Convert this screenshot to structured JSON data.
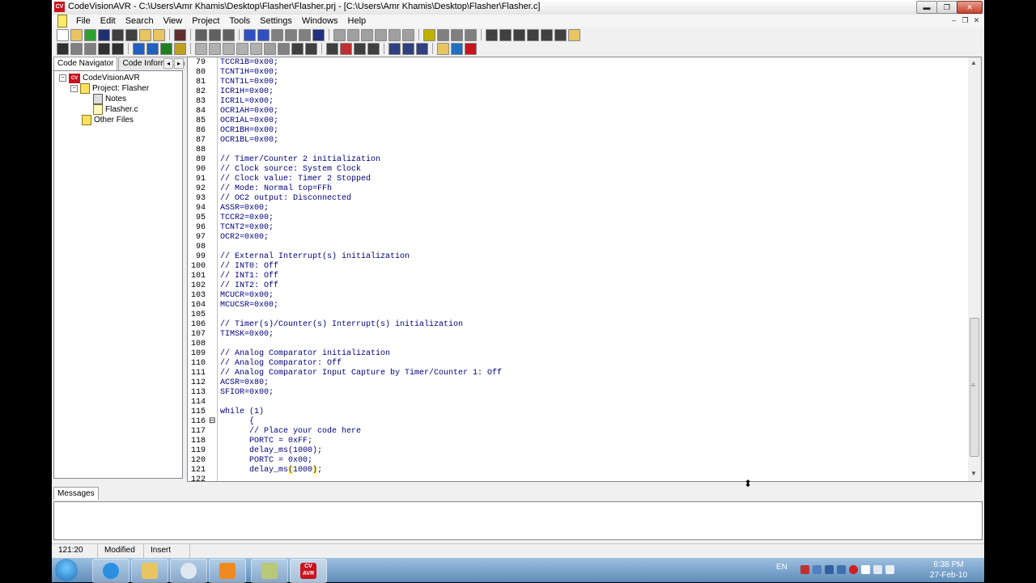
{
  "window": {
    "title": "CodeVisionAVR - C:\\Users\\Amr Khamis\\Desktop\\Flasher\\Flasher.prj - [C:\\Users\\Amr Khamis\\Desktop\\Flasher\\Flasher.c]",
    "app_icon_text": "CV",
    "controls": {
      "minimize": "▬",
      "maximize": "❐",
      "close": "✕"
    }
  },
  "menu": [
    "File",
    "Edit",
    "Search",
    "View",
    "Project",
    "Tools",
    "Settings",
    "Windows",
    "Help"
  ],
  "mdi_controls": {
    "minimize": "–",
    "restore": "❐",
    "close": "✕"
  },
  "left_panel": {
    "tabs": [
      "Code Navigator",
      "Code Information"
    ],
    "arrows": [
      "◂",
      "▸"
    ],
    "tree": {
      "root": "CodeVisionAVR",
      "project": "Project: Flasher",
      "notes": "Notes",
      "file": "Flasher.c",
      "other": "Other Files",
      "expand_glyph": "−"
    }
  },
  "editor": {
    "lines": [
      {
        "n": "79",
        "t": "TCCR1B=0x00;"
      },
      {
        "n": "80",
        "t": "TCNT1H=0x00;"
      },
      {
        "n": "81",
        "t": "TCNT1L=0x00;"
      },
      {
        "n": "82",
        "t": "ICR1H=0x00;"
      },
      {
        "n": "83",
        "t": "ICR1L=0x00;"
      },
      {
        "n": "84",
        "t": "OCR1AH=0x00;"
      },
      {
        "n": "85",
        "t": "OCR1AL=0x00;"
      },
      {
        "n": "86",
        "t": "OCR1BH=0x00;"
      },
      {
        "n": "87",
        "t": "OCR1BL=0x00;"
      },
      {
        "n": "88",
        "t": ""
      },
      {
        "n": "89",
        "t": "// Timer/Counter 2 initialization"
      },
      {
        "n": "90",
        "t": "// Clock source: System Clock"
      },
      {
        "n": "91",
        "t": "// Clock value: Timer 2 Stopped"
      },
      {
        "n": "92",
        "t": "// Mode: Normal top=FFh"
      },
      {
        "n": "93",
        "t": "// OC2 output: Disconnected"
      },
      {
        "n": "94",
        "t": "ASSR=0x00;"
      },
      {
        "n": "95",
        "t": "TCCR2=0x00;"
      },
      {
        "n": "96",
        "t": "TCNT2=0x00;"
      },
      {
        "n": "97",
        "t": "OCR2=0x00;"
      },
      {
        "n": "98",
        "t": ""
      },
      {
        "n": "99",
        "t": "// External Interrupt(s) initialization"
      },
      {
        "n": "100",
        "t": "// INT0: Off"
      },
      {
        "n": "101",
        "t": "// INT1: Off"
      },
      {
        "n": "102",
        "t": "// INT2: Off"
      },
      {
        "n": "103",
        "t": "MCUCR=0x00;"
      },
      {
        "n": "104",
        "t": "MCUCSR=0x00;"
      },
      {
        "n": "105",
        "t": ""
      },
      {
        "n": "106",
        "t": "// Timer(s)/Counter(s) Interrupt(s) initialization"
      },
      {
        "n": "107",
        "t": "TIMSK=0x00;"
      },
      {
        "n": "108",
        "t": ""
      },
      {
        "n": "109",
        "t": "// Analog Comparator initialization"
      },
      {
        "n": "110",
        "t": "// Analog Comparator: Off"
      },
      {
        "n": "111",
        "t": "// Analog Comparator Input Capture by Timer/Counter 1: Off"
      },
      {
        "n": "112",
        "t": "ACSR=0x80;"
      },
      {
        "n": "113",
        "t": "SFIOR=0x00;"
      },
      {
        "n": "114",
        "t": ""
      },
      {
        "n": "115",
        "t": "while (1)"
      },
      {
        "n": "116",
        "t": "      {"
      },
      {
        "n": "117",
        "t": "      // Place your code here"
      },
      {
        "n": "118",
        "t": "      PORTC = 0xFF;"
      },
      {
        "n": "119",
        "t": "      delay_ms(1000);"
      },
      {
        "n": "120",
        "t": "      PORTC = 0x00;"
      },
      {
        "n": "121",
        "t": "      delay_ms(1000);"
      },
      {
        "n": "122",
        "t": ""
      }
    ],
    "fold_glyph": "⊟",
    "line121_pre": "      delay_ms",
    "line121_hl_open": "(",
    "line121_mid": "1000",
    "line121_hl_close": ")",
    "line121_post": ";",
    "scroll_up": "▲",
    "scroll_down": "▼",
    "scroll_grip": "≡"
  },
  "messages": {
    "tab": "Messages"
  },
  "statusbar": {
    "position": "121:20",
    "modified": "Modified",
    "mode": "Insert"
  },
  "taskbar": {
    "language": "EN",
    "time": "6:38 PM",
    "date": "27-Feb-10",
    "cv_button_text": "CV\nAVR"
  },
  "colors": {
    "code_text": "#000080",
    "line_highlight": "#fff59a",
    "taskbar": "#6f9ac4"
  }
}
